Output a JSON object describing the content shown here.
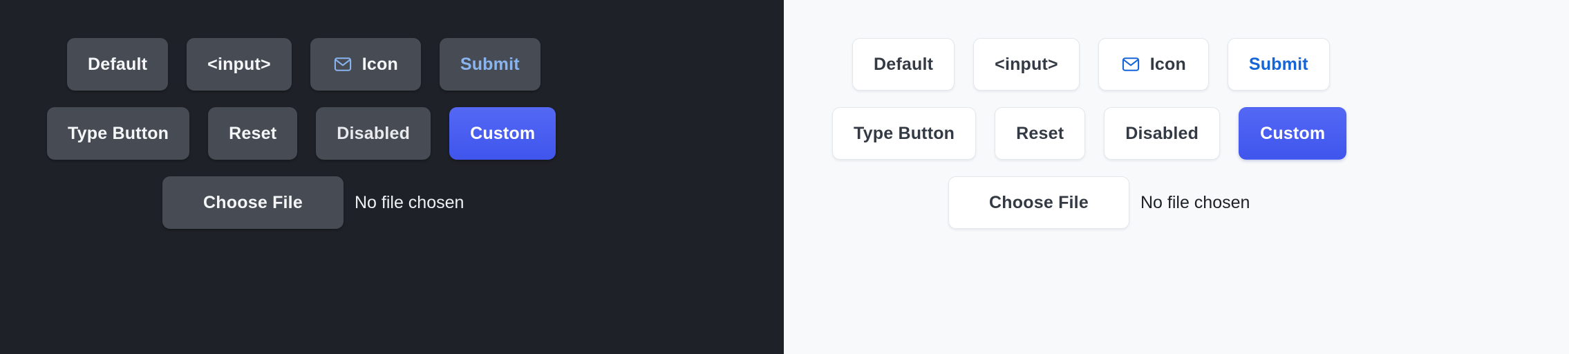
{
  "panels": [
    {
      "theme": "dark",
      "background_color": "#1e2228",
      "button_bg": "#474c54",
      "text_color": "#f4f6f8",
      "accent_submit": "#8ab4f0",
      "accent_custom": "#4f63f0",
      "rows": [
        {
          "name": "variants-row",
          "buttons": [
            {
              "label": "Default",
              "variant": "default",
              "icon": null
            },
            {
              "label": "<input>",
              "variant": "input",
              "icon": null
            },
            {
              "label": "Icon",
              "variant": "icon",
              "icon": "mail-icon"
            },
            {
              "label": "Submit",
              "variant": "submit",
              "icon": null
            }
          ]
        },
        {
          "name": "types-row",
          "buttons": [
            {
              "label": "Type Button",
              "variant": "type",
              "icon": null
            },
            {
              "label": "Reset",
              "variant": "reset",
              "icon": null
            },
            {
              "label": "Disabled",
              "variant": "disabled",
              "icon": null
            },
            {
              "label": "Custom",
              "variant": "custom",
              "icon": null
            }
          ]
        }
      ],
      "file_input": {
        "button_label": "Choose File",
        "status_text": "No file chosen"
      }
    },
    {
      "theme": "light",
      "background_color": "#f7f9fb",
      "button_bg": "#ffffff",
      "border_color": "#e3e7ec",
      "text_color": "#343a44",
      "accent_submit": "#1565d8",
      "accent_custom": "#4f63f0",
      "rows": [
        {
          "name": "variants-row",
          "buttons": [
            {
              "label": "Default",
              "variant": "default",
              "icon": null
            },
            {
              "label": "<input>",
              "variant": "input",
              "icon": null
            },
            {
              "label": "Icon",
              "variant": "icon",
              "icon": "mail-icon"
            },
            {
              "label": "Submit",
              "variant": "submit",
              "icon": null
            }
          ]
        },
        {
          "name": "types-row",
          "buttons": [
            {
              "label": "Type Button",
              "variant": "type",
              "icon": null
            },
            {
              "label": "Reset",
              "variant": "reset",
              "icon": null
            },
            {
              "label": "Disabled",
              "variant": "disabled",
              "icon": null
            },
            {
              "label": "Custom",
              "variant": "custom",
              "icon": null
            }
          ]
        }
      ],
      "file_input": {
        "button_label": "Choose File",
        "status_text": "No file chosen"
      }
    }
  ]
}
